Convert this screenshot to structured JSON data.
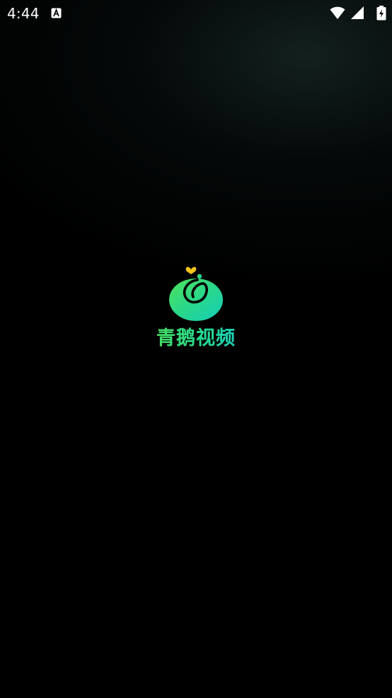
{
  "status_bar": {
    "time": "4:44",
    "notification_icon": "accessibility-a-icon",
    "wifi_icon": "wifi-icon",
    "signal_icon": "cell-signal-icon",
    "battery_icon": "battery-charging-icon"
  },
  "splash": {
    "logo_icon": "goose-logo-icon",
    "app_name": "青鹅视频"
  },
  "colors": {
    "background": "#000000",
    "brand_green": "#3fdc68",
    "brand_teal": "#1fcfb4",
    "logo_heart": "#f5c518"
  }
}
